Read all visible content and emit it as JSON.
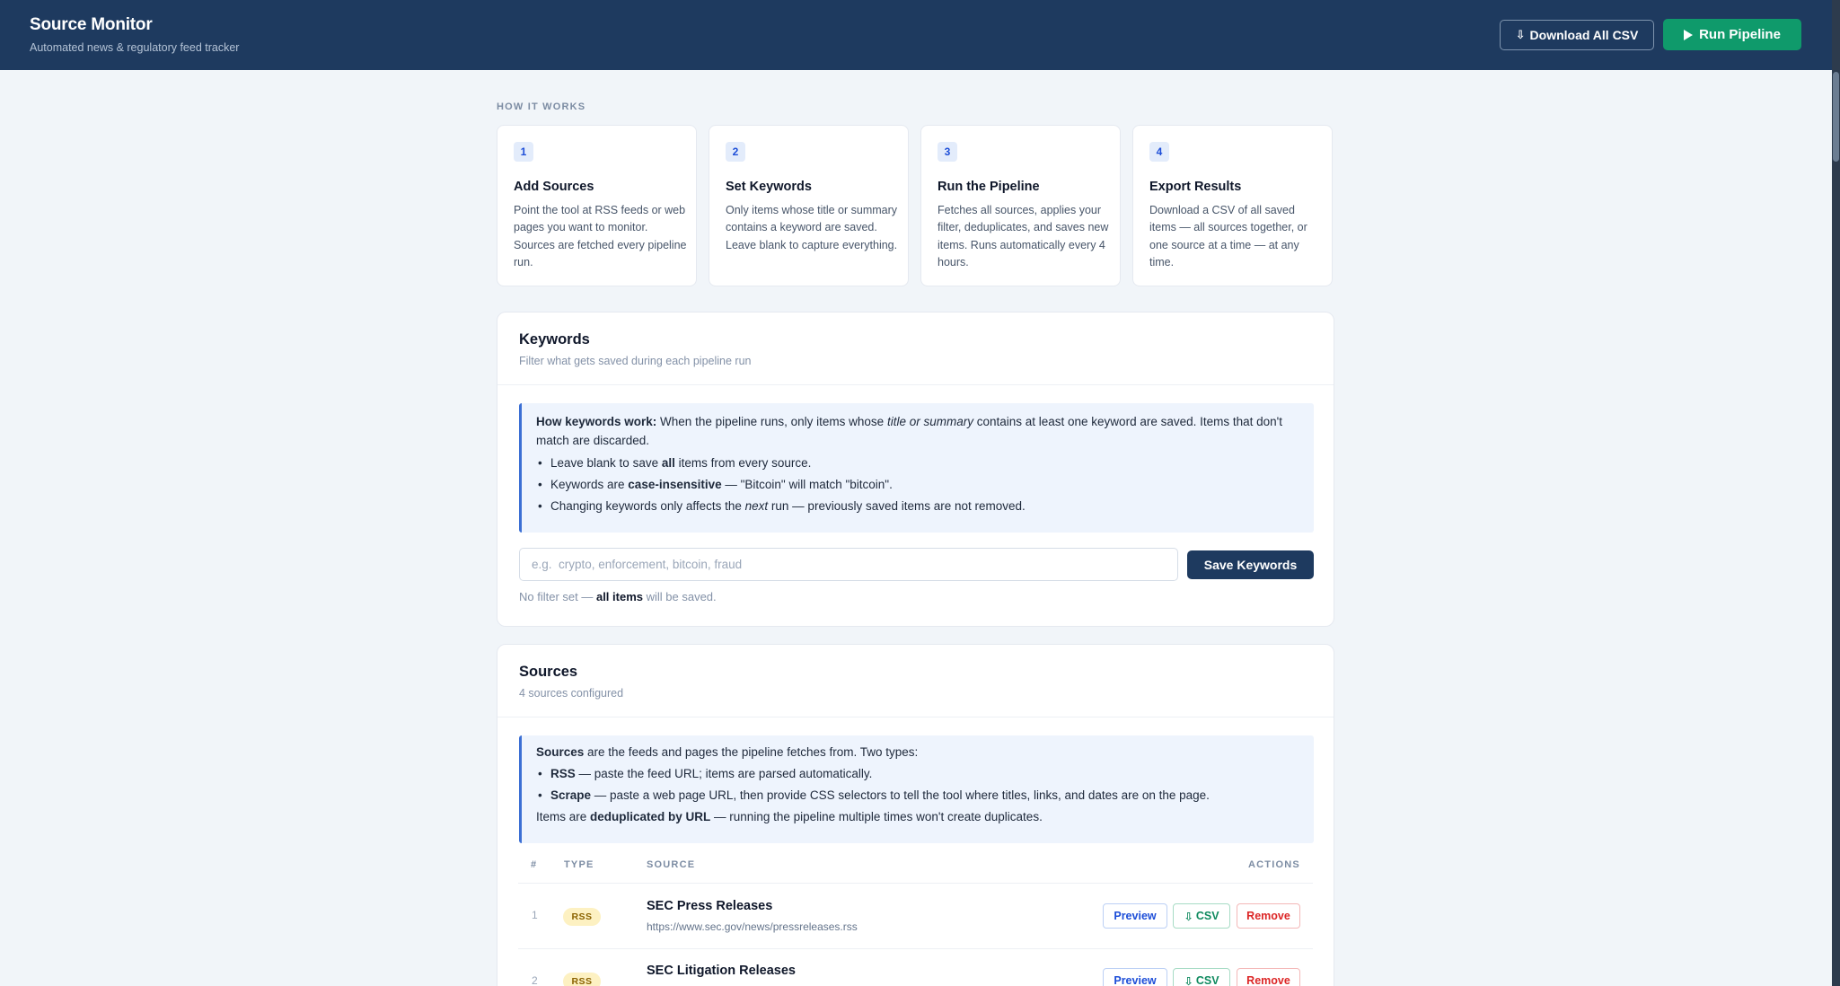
{
  "header": {
    "title": "Source Monitor",
    "subtitle": "Automated news & regulatory feed tracker",
    "download_all_label": "Download All CSV",
    "run_label": "Run Pipeline"
  },
  "how_it_works": {
    "label": "HOW IT WORKS",
    "steps": [
      {
        "num": "1",
        "title": "Add Sources",
        "desc": "Point the tool at RSS feeds or web pages you want to monitor. Sources are fetched every pipeline run."
      },
      {
        "num": "2",
        "title": "Set Keywords",
        "desc": "Only items whose title or summary contains a keyword are saved. Leave blank to capture everything."
      },
      {
        "num": "3",
        "title": "Run the Pipeline",
        "desc": "Fetches all sources, applies your filter, deduplicates, and saves new items. Runs automatically every 4 hours."
      },
      {
        "num": "4",
        "title": "Export Results",
        "desc": "Download a CSV of all saved items — all sources together, or one source at a time — at any time."
      }
    ]
  },
  "keywords": {
    "title": "Keywords",
    "subtitle": "Filter what gets saved during each pipeline run",
    "info_lead": "How keywords work:",
    "info_text_1": " When the pipeline runs, only items whose ",
    "info_em": "title or summary",
    "info_text_2": " contains at least one keyword are saved. Items that don't match are discarded.",
    "bullet1_a": "Leave blank to save ",
    "bullet1_b": "all",
    "bullet1_c": " items from every source.",
    "bullet2_a": "Keywords are ",
    "bullet2_b": "case-insensitive",
    "bullet2_c": " — \"Bitcoin\" will match \"bitcoin\".",
    "bullet3_a": "Changing keywords only affects the ",
    "bullet3_b": "next",
    "bullet3_c": " run — previously saved items are not removed.",
    "input_value": "",
    "input_placeholder": "e.g.  crypto, enforcement, bitcoin, fraud",
    "save_label": "Save Keywords",
    "status_a": "No filter set — ",
    "status_b": "all items",
    "status_c": " will be saved."
  },
  "sources": {
    "title": "Sources",
    "subtitle": "4 sources configured",
    "info_lead": "Sources",
    "info_text": " are the feeds and pages the pipeline fetches from. Two types:",
    "b1_lead": "RSS",
    "b1_text": " — paste the feed URL; items are parsed automatically.",
    "b2_lead": "Scrape",
    "b2_text": " — paste a web page URL, then provide CSS selectors to tell the tool where titles, links, and dates are on the page.",
    "dedup_a": "Items are ",
    "dedup_b": "deduplicated by URL",
    "dedup_c": " — running the pipeline multiple times won't create duplicates.",
    "columns": {
      "num": "#",
      "type": "TYPE",
      "source": "SOURCE",
      "actions": "ACTIONS"
    },
    "rows": [
      {
        "num": "1",
        "type": "RSS",
        "name": "SEC Press Releases",
        "url": "https://www.sec.gov/news/pressreleases.rss",
        "preview": "Preview",
        "csv": "CSV",
        "remove": "Remove"
      },
      {
        "num": "2",
        "type": "RSS",
        "name": "SEC Litigation Releases",
        "url": "",
        "preview": "Preview",
        "csv": "CSV",
        "remove": "Remove"
      }
    ]
  }
}
